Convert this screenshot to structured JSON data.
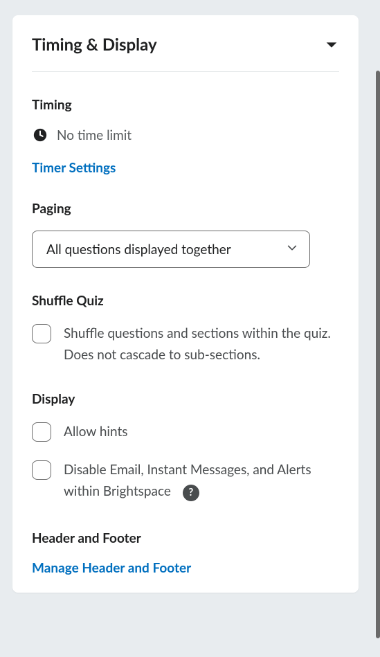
{
  "panel": {
    "title": "Timing & Display"
  },
  "timing": {
    "label": "Timing",
    "status": "No time limit",
    "link": "Timer Settings"
  },
  "paging": {
    "label": "Paging",
    "selected": "All questions displayed together"
  },
  "shuffle": {
    "label": "Shuffle Quiz",
    "checkbox_label": "Shuffle questions and sections within the quiz. Does not cascade to sub-sections."
  },
  "display": {
    "label": "Display",
    "hints_label": "Allow hints",
    "disable_label": "Disable Email, Instant Messages, and Alerts within Brightspace"
  },
  "header_footer": {
    "label": "Header and Footer",
    "link": "Manage Header and Footer"
  }
}
